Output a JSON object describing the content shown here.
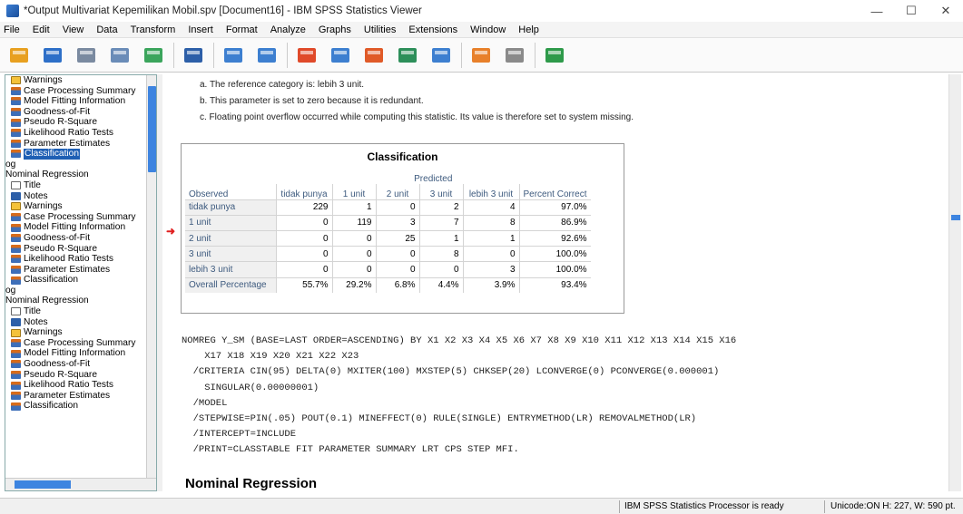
{
  "window": {
    "title": "*Output Multivariat Kepemilikan Mobil.spv [Document16] - IBM SPSS Statistics Viewer",
    "minimize": "—",
    "maximize": "☐",
    "close": "✕"
  },
  "menu": [
    "File",
    "Edit",
    "View",
    "Data",
    "Transform",
    "Insert",
    "Format",
    "Analyze",
    "Graphs",
    "Utilities",
    "Extensions",
    "Window",
    "Help"
  ],
  "toolbar_icons": [
    "open-icon",
    "save-icon",
    "print-icon",
    "print-preview-icon",
    "export-icon",
    "goto-data-icon",
    "undo-icon",
    "redo-icon",
    "goto-case-icon",
    "goto-variable-icon",
    "insert-cases-icon",
    "variables-icon",
    "show-all-icon",
    "spell-check-icon",
    "designate-window-icon",
    "add-output-icon"
  ],
  "nav": {
    "items": [
      {
        "label": "Warnings",
        "icon": "warn",
        "level": 1
      },
      {
        "label": "Case Processing Summary",
        "icon": "table",
        "level": 1
      },
      {
        "label": "Model Fitting Information",
        "icon": "table",
        "level": 1
      },
      {
        "label": "Goodness-of-Fit",
        "icon": "table",
        "level": 1
      },
      {
        "label": "Pseudo R-Square",
        "icon": "table",
        "level": 1
      },
      {
        "label": "Likelihood Ratio Tests",
        "icon": "table",
        "level": 1
      },
      {
        "label": "Parameter Estimates",
        "icon": "table",
        "level": 1
      },
      {
        "label": "Classification",
        "icon": "table",
        "level": 1,
        "selected": true
      },
      {
        "label": "og",
        "icon": "log",
        "level": 0
      },
      {
        "label": "Nominal Regression",
        "icon": "log",
        "level": 0
      },
      {
        "label": "Title",
        "icon": "title",
        "level": 1
      },
      {
        "label": "Notes",
        "icon": "notes",
        "level": 1
      },
      {
        "label": "Warnings",
        "icon": "warn",
        "level": 1
      },
      {
        "label": "Case Processing Summary",
        "icon": "table",
        "level": 1
      },
      {
        "label": "Model Fitting Information",
        "icon": "table",
        "level": 1
      },
      {
        "label": "Goodness-of-Fit",
        "icon": "table",
        "level": 1
      },
      {
        "label": "Pseudo R-Square",
        "icon": "table",
        "level": 1
      },
      {
        "label": "Likelihood Ratio Tests",
        "icon": "table",
        "level": 1
      },
      {
        "label": "Parameter Estimates",
        "icon": "table",
        "level": 1
      },
      {
        "label": "Classification",
        "icon": "table",
        "level": 1
      },
      {
        "label": "og",
        "icon": "log",
        "level": 0
      },
      {
        "label": "Nominal Regression",
        "icon": "log",
        "level": 0
      },
      {
        "label": "Title",
        "icon": "title",
        "level": 1
      },
      {
        "label": "Notes",
        "icon": "notes",
        "level": 1
      },
      {
        "label": "Warnings",
        "icon": "warn",
        "level": 1
      },
      {
        "label": "Case Processing Summary",
        "icon": "table",
        "level": 1
      },
      {
        "label": "Model Fitting Information",
        "icon": "table",
        "level": 1
      },
      {
        "label": "Goodness-of-Fit",
        "icon": "table",
        "level": 1
      },
      {
        "label": "Pseudo R-Square",
        "icon": "table",
        "level": 1
      },
      {
        "label": "Likelihood Ratio Tests",
        "icon": "table",
        "level": 1
      },
      {
        "label": "Parameter Estimates",
        "icon": "table",
        "level": 1
      },
      {
        "label": "Classification",
        "icon": "table",
        "level": 1
      }
    ]
  },
  "footnotes": [
    "a. The reference category is: lebih 3 unit.",
    "b. This parameter is set to zero because it is redundant.",
    "c. Floating point overflow occurred while computing this statistic. Its value is therefore set to system missing."
  ],
  "classification": {
    "title": "Classification",
    "predicted_label": "Predicted",
    "observed_label": "Observed",
    "columns": [
      "tidak punya",
      "1 unit",
      "2 unit",
      "3 unit",
      "lebih 3 unit",
      "Percent Correct"
    ],
    "rows": [
      {
        "label": "tidak punya",
        "values": [
          "229",
          "1",
          "0",
          "2",
          "4",
          "97.0%"
        ]
      },
      {
        "label": "1 unit",
        "values": [
          "0",
          "119",
          "3",
          "7",
          "8",
          "86.9%"
        ]
      },
      {
        "label": "2 unit",
        "values": [
          "0",
          "0",
          "25",
          "1",
          "1",
          "92.6%"
        ]
      },
      {
        "label": "3 unit",
        "values": [
          "0",
          "0",
          "0",
          "8",
          "0",
          "100.0%"
        ]
      },
      {
        "label": "lebih 3 unit",
        "values": [
          "0",
          "0",
          "0",
          "0",
          "3",
          "100.0%"
        ]
      },
      {
        "label": "Overall Percentage",
        "values": [
          "55.7%",
          "29.2%",
          "6.8%",
          "4.4%",
          "3.9%",
          "93.4%"
        ]
      }
    ]
  },
  "syntax": [
    "NOMREG Y_SM (BASE=LAST ORDER=ASCENDING) BY X1 X2 X3 X4 X5 X6 X7 X8 X9 X10 X11 X12 X13 X14 X15 X16",
    "    X17 X18 X19 X20 X21 X22 X23",
    "  /CRITERIA CIN(95) DELTA(0) MXITER(100) MXSTEP(5) CHKSEP(20) LCONVERGE(0) PCONVERGE(0.000001)",
    "    SINGULAR(0.00000001)",
    "  /MODEL",
    "  /STEPWISE=PIN(.05) POUT(0.1) MINEFFECT(0) RULE(SINGLE) ENTRYMETHOD(LR) REMOVALMETHOD(LR)",
    "  /INTERCEPT=INCLUDE",
    "  /PRINT=CLASSTABLE FIT PARAMETER SUMMARY LRT CPS STEP MFI."
  ],
  "heading": "Nominal Regression",
  "status": {
    "processor": "IBM SPSS Statistics Processor is ready",
    "info": "Unicode:ON  H: 227, W: 590 pt."
  }
}
